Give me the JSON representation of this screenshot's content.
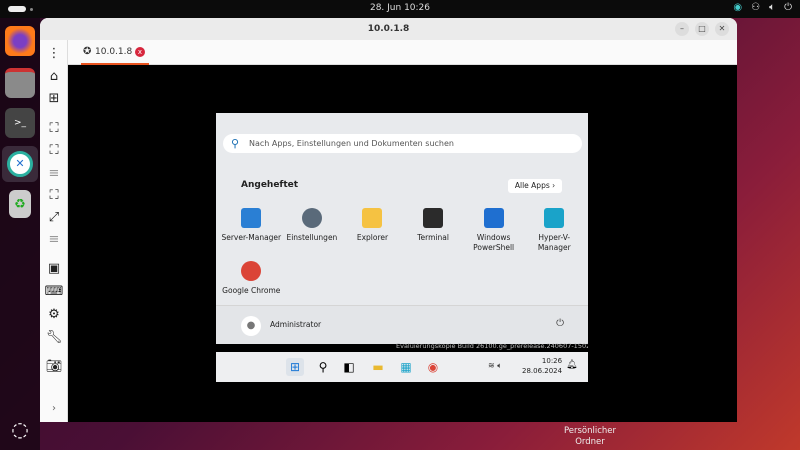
{
  "topbar": {
    "clock": "28. Jun  10:26"
  },
  "window": {
    "title": "10.0.1.8",
    "tab_label": "10.0.1.8"
  },
  "start_menu": {
    "search_placeholder": "Nach Apps, Einstellungen und Dokumenten suchen",
    "pinned_heading": "Angeheftet",
    "all_apps": "Alle Apps  ›",
    "apps": [
      {
        "label": "Server-Manager",
        "color": "#2a7fd4"
      },
      {
        "label": "Einstellungen",
        "color": "#5a6a7a"
      },
      {
        "label": "Explorer",
        "color": "#f5c242"
      },
      {
        "label": "Terminal",
        "color": "#2b2b2b"
      },
      {
        "label": "Windows PowerShell",
        "color": "#1f6fd0"
      },
      {
        "label": "Hyper-V-Manager",
        "color": "#1aa3c9"
      },
      {
        "label": "Google Chrome",
        "color": "#db4437"
      }
    ],
    "user": "Administrator"
  },
  "watermark": "Evaluierungskopie Build 26100.ge_prerelease.240607-1502",
  "taskbar": {
    "time": "10:26",
    "date": "28.06.2024"
  },
  "desktop": {
    "home_folder": "Persönlicher Ordner"
  }
}
